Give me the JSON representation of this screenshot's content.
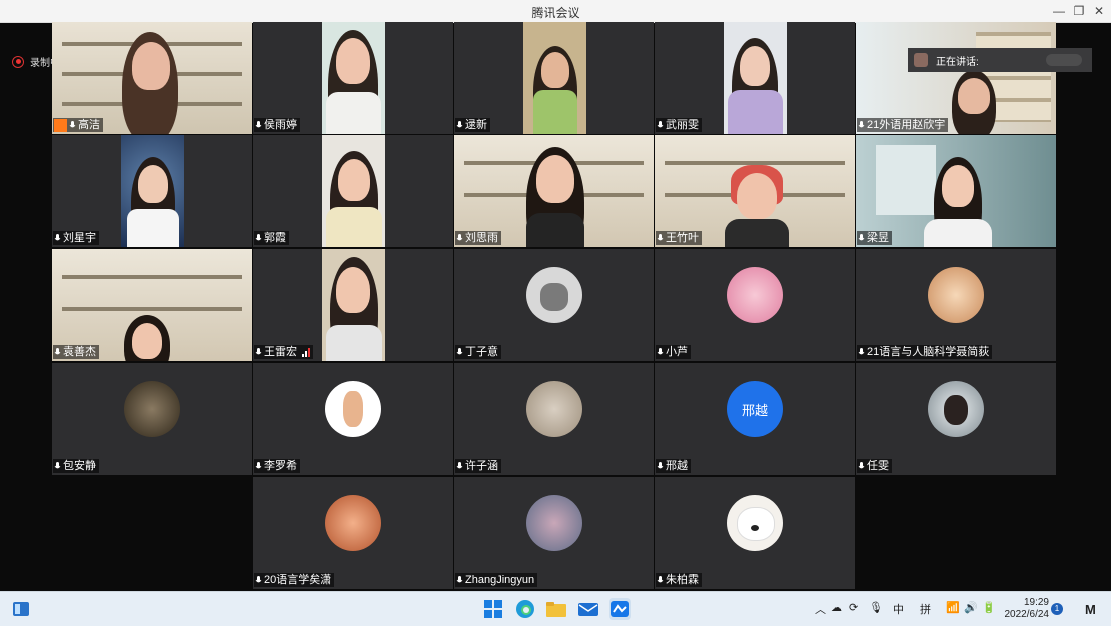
{
  "window": {
    "title": "腾讯会议"
  },
  "recording": {
    "label": "录制中"
  },
  "speaking": {
    "label": "正在讲话:"
  },
  "participants": [
    {
      "name": "高洁"
    },
    {
      "name": "侯雨婷"
    },
    {
      "name": "逯新"
    },
    {
      "name": "武丽雯"
    },
    {
      "name": "21外语用赵欣宇"
    },
    {
      "name": "刘星宇"
    },
    {
      "name": "郭霞"
    },
    {
      "name": "刘思雨"
    },
    {
      "name": "王竹叶"
    },
    {
      "name": "梁昱"
    },
    {
      "name": "袁善杰"
    },
    {
      "name": "王雷宏"
    },
    {
      "name": "丁子意"
    },
    {
      "name": "小芦"
    },
    {
      "name": "21语言与人脑科学聂简荻"
    },
    {
      "name": "包安静"
    },
    {
      "name": "李罗希"
    },
    {
      "name": "许子涵"
    },
    {
      "name": "邢越",
      "avatar_text": "邢越"
    },
    {
      "name": "任雯"
    },
    {
      "name": "20语言学矣潇"
    },
    {
      "name": "ZhangJingyun"
    },
    {
      "name": "朱柏霖"
    }
  ],
  "taskbar": {
    "ime_mode": "中",
    "ime_name": "拼",
    "time": "19:29",
    "date": "2022/6/24",
    "notification_count": "1"
  },
  "colors": {
    "tile_bg": "#2e2e30",
    "avatar_blue": "#1f72ea",
    "taskbar_bg": "#e6eef6"
  }
}
